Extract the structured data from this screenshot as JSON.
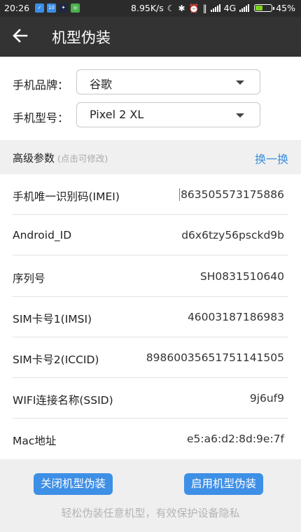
{
  "status_bar": {
    "time": "20:26",
    "notification_icons": [
      "app-notify-icon",
      "qq-notify-icon",
      "game-notify-icon",
      "wechat-notify-icon"
    ],
    "net_speed": "8.95K/s",
    "network": "4G",
    "battery": "45%",
    "battery_level": 0.45
  },
  "app_bar": {
    "title": "机型伪装"
  },
  "brand": {
    "label": "手机品牌：",
    "value": "谷歌"
  },
  "model": {
    "label": "手机型号：",
    "value": "Pixel 2 XL"
  },
  "advanced": {
    "title": "高级参数",
    "hint": "(点击可修改)",
    "switch_label": "换一换"
  },
  "params": [
    {
      "key": "手机唯一识别码(IMEI)",
      "value": "863505573175886"
    },
    {
      "key": "Android_ID",
      "value": "d6x6tzy56psckd9b"
    },
    {
      "key": "序列号",
      "value": "SH0831510640"
    },
    {
      "key": "SIM卡号1(IMSI)",
      "value": "46003187186983"
    },
    {
      "key": "SIM卡号2(ICCID)",
      "value": "89860035651751141505"
    },
    {
      "key": "WIFI连接名称(SSID)",
      "value": "9j6uf9"
    },
    {
      "key": "Mac地址",
      "value": "e5:a6:d2:8d:9e:7f"
    }
  ],
  "footer": {
    "disable_label": "关闭机型伪装",
    "enable_label": "启用机型伪装",
    "slogan": "轻松伪装任意机型，有效保护设备隐私"
  },
  "colors": {
    "accent": "#3e8fe6",
    "app_bar": "#333333",
    "status_bar": "#2b2b2b",
    "battery": "#7ed321"
  }
}
